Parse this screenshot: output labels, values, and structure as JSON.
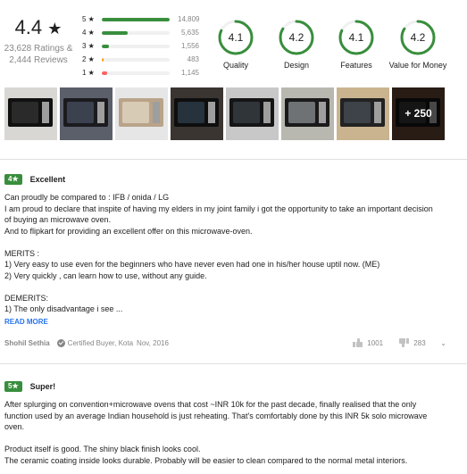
{
  "summary": {
    "overall_rating": "4.4",
    "star_glyph": "★",
    "ratings_count": "23,628 Ratings &",
    "reviews_count": "2,444 Reviews",
    "distribution": [
      {
        "label": "5 ★",
        "count": "14,809",
        "value": 14809,
        "color": "#388e3c"
      },
      {
        "label": "4 ★",
        "count": "5,635",
        "value": 5635,
        "color": "#388e3c"
      },
      {
        "label": "3 ★",
        "count": "1,556",
        "value": 1556,
        "color": "#388e3c"
      },
      {
        "label": "2 ★",
        "count": "483",
        "value": 483,
        "color": "#ff9f00"
      },
      {
        "label": "1 ★",
        "count": "1,145",
        "value": 1145,
        "color": "#ff6161"
      }
    ],
    "aspects": [
      {
        "name": "Quality",
        "value": "4.1",
        "score": 4.1
      },
      {
        "name": "Design",
        "value": "4.2",
        "score": 4.2
      },
      {
        "name": "Features",
        "value": "4.1",
        "score": 4.1
      },
      {
        "name": "Value for Money",
        "value": "4.2",
        "score": 4.2
      }
    ],
    "aspect_color": "#388e3c"
  },
  "photos": {
    "count": 8,
    "more_label": "+ 250"
  },
  "reviews": [
    {
      "rating": "4★",
      "title": "Excellent",
      "lines": [
        "Can proudly be compared to : IFB / onida / LG",
        "I am proud to declare that inspite of having my elders in my joint family i got the opportunity to take an important decision",
        "of buying an microwave oven.",
        "And to flipkart for providing an excellent offer on this microwave-oven.",
        "",
        "MERITS :",
        "1) Very easy to use even for the beginners who have never even had one in his/her house uptil now. (ME)",
        "2) Very quickly , can learn how to use, without any guide.",
        "",
        "DEMERITS:",
        "1) The only disadvantage i see ..."
      ],
      "read_more": "READ MORE",
      "author": "Shohil Sethia",
      "certified": "Certified Buyer, Kota",
      "date": "Nov, 2016",
      "upvotes": "1001",
      "downvotes": "283"
    },
    {
      "rating": "5★",
      "title": "Super!",
      "lines": [
        "After splurging on convention+microwave ovens that cost ~INR 10k for the past decade, finally realised that the only",
        "function used by an average Indian household is just reheating. That's comfortably done by this INR 5k solo microwave",
        "oven.",
        "",
        "Product itself is good. The shiny black finish looks cool.",
        "The ceramic coating inside looks durable. Probably will be easier to clean compared to the normal metal interiors."
      ]
    }
  ]
}
